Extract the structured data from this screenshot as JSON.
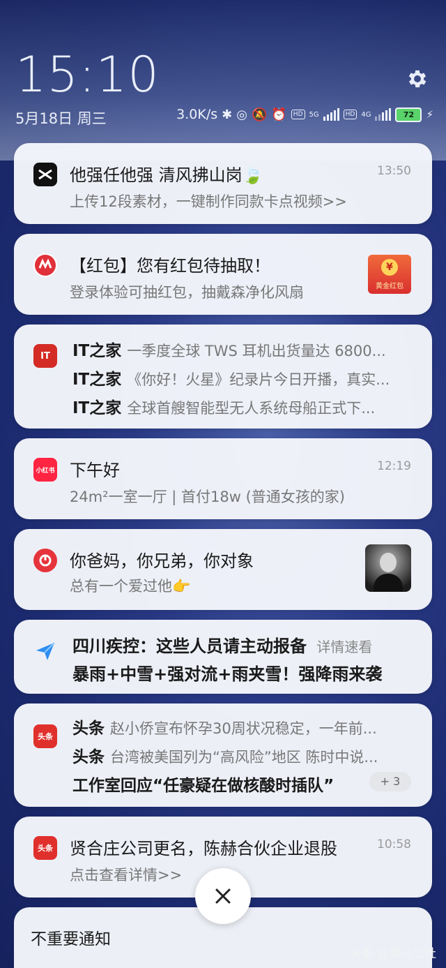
{
  "header": {
    "time": "15:10",
    "date": "5月18日  周三",
    "network_speed": "3.0K/s",
    "sim1_badge": "HD",
    "sim1_net": "5G",
    "sim2_badge": "HD",
    "sim2_net": "4G",
    "battery": "72"
  },
  "notifications": [
    {
      "title": "他强任他强 清风拂山岗🍃",
      "subtitle": "上传12段素材，一键制作同款卡点视频>>",
      "time": "13:50"
    },
    {
      "title": "【红包】您有红包待抽取！",
      "subtitle": "登录体验可抽红包，抽戴森净化风扇",
      "thumb_text": "黄金红包",
      "thumb_symbol": "¥"
    },
    {
      "icon_text": "IT",
      "rows": [
        {
          "app": "IT之家",
          "text": "一季度全球 TWS 耳机出货量达 6800..."
        },
        {
          "app": "IT之家",
          "text": "《你好！火星》纪录片今日开播，真实..."
        },
        {
          "app": "IT之家",
          "text": "全球首艘智能型无人系统母船正式下..."
        }
      ]
    },
    {
      "icon_text": "小红书",
      "title": "下午好",
      "subtitle": "24m²一室一厅 | 首付18w (普通女孩的家)",
      "time": "12:19"
    },
    {
      "title": "你爸妈，你兄弟，你对象",
      "subtitle": "总有一个爱过他👉"
    },
    {
      "title": "四川疾控：这些人员请主动报备",
      "title_suffix": "详情速看",
      "subtitle": "暴雨+中雪+强对流+雨夹雪！强降雨来袭"
    },
    {
      "icon_text": "头条",
      "rows": [
        {
          "app": "头条",
          "text": "赵小侨宣布怀孕30周状况稳定，一年前..."
        },
        {
          "app": "头条",
          "text": "台湾被美国列为“高风险”地区 陈时中说..."
        }
      ],
      "bold_line": "工作室回应“任豪疑在做核酸时插队”",
      "more_badge": "+ 3"
    },
    {
      "icon_text": "头条",
      "title": "贤合庄公司更名，陈赫合伙企业退股",
      "subtitle": "点击查看详情>>",
      "time": "10:58"
    }
  ],
  "unimportant_label": "不重要通知",
  "watermark": "头条 @黑马公社",
  "colors": {
    "background": "#1b2a6e",
    "card": "#f4f6fb",
    "red_icon": "#e0303a",
    "accent_green": "#59d36a"
  }
}
